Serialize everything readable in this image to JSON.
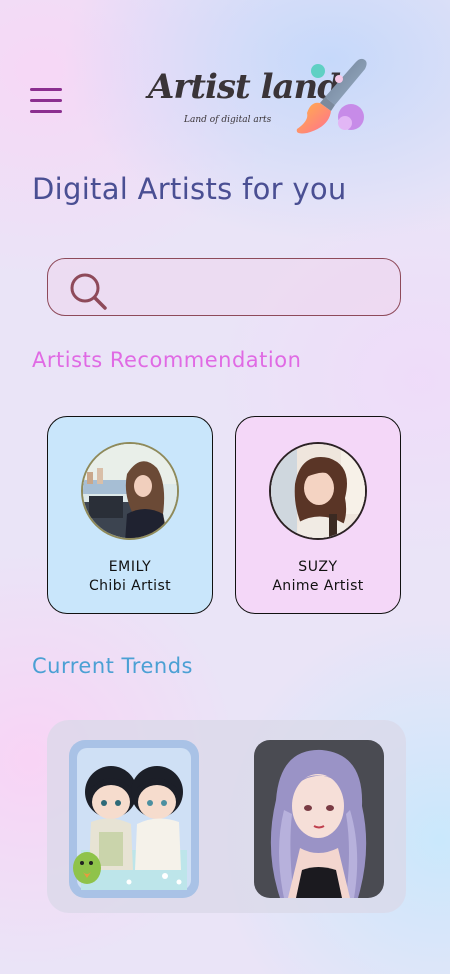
{
  "header": {
    "menu_icon": "hamburger-menu-icon",
    "logo_title": "Artist land",
    "logo_subtitle": "Land of digital arts",
    "logo_icon": "paintbrush-icon"
  },
  "page_title": "Digital Artists for you",
  "search": {
    "placeholder": "",
    "value": "",
    "icon": "search-icon"
  },
  "recommendations": {
    "heading": "Artists Recommendation",
    "artists": [
      {
        "name": "EMILY",
        "role": "Chibi Artist",
        "bg": "#c9e6fb"
      },
      {
        "name": "SUZY",
        "role": "Anime Artist",
        "bg": "#f4d7f8"
      }
    ]
  },
  "trends": {
    "heading": "Current Trends"
  },
  "colors": {
    "title": "#4a4f93",
    "recommendation_heading": "#e06ae4",
    "trends_heading": "#4ba0d4",
    "menu": "#8b2f8f"
  }
}
